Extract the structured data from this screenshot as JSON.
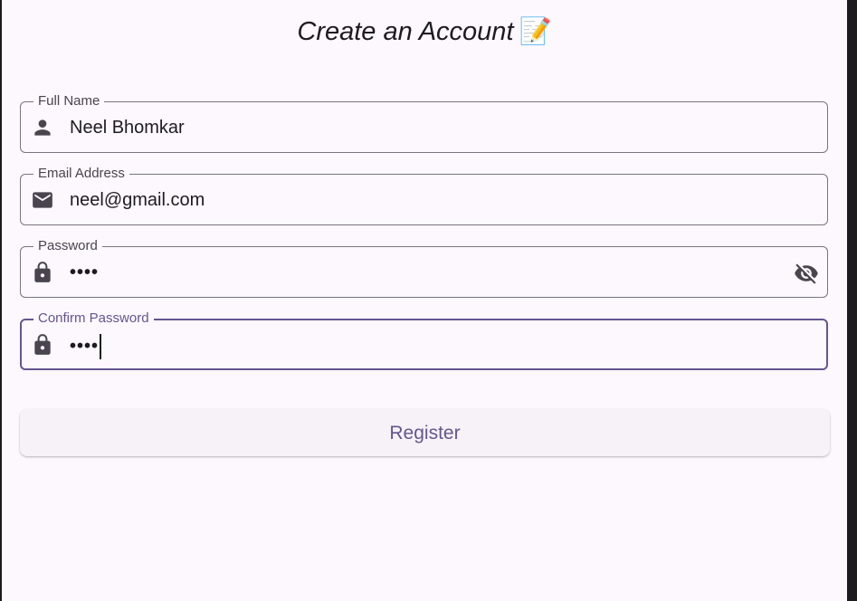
{
  "page": {
    "title": "Create an Account",
    "title_emoji": "📝"
  },
  "form": {
    "full_name": {
      "label": "Full Name",
      "value": "Neel Bhomkar",
      "icon": "person-icon"
    },
    "email": {
      "label": "Email Address",
      "value": "neel@gmail.com",
      "icon": "mail-icon"
    },
    "password": {
      "label": "Password",
      "value": "••••",
      "icon": "lock-icon",
      "toggle_icon": "eye-off-icon"
    },
    "confirm_password": {
      "label": "Confirm Password",
      "value": "••••",
      "icon": "lock-icon",
      "focused": true
    },
    "register_label": "Register"
  },
  "colors": {
    "background": "#fdf7fe",
    "primary": "#65558f",
    "outline": "#79747e",
    "on_surface": "#1d1b20",
    "icon": "#49454f"
  }
}
